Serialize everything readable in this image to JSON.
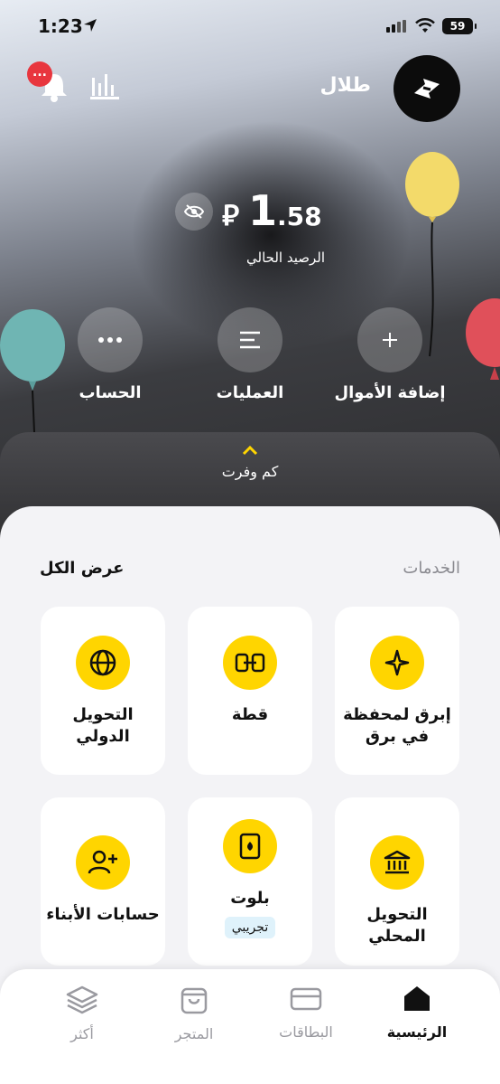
{
  "status_bar": {
    "time": "1:23",
    "battery": "59"
  },
  "header": {
    "user_name": "طلال",
    "notification_badge": "..."
  },
  "balance": {
    "currency_symbol": "⃁",
    "integer": "1",
    "decimal": ".58",
    "label": "الرصيد الحالي"
  },
  "quick_actions": [
    {
      "label": "إضافة الأموال",
      "icon": "plus-icon"
    },
    {
      "label": "العمليات",
      "icon": "list-icon"
    },
    {
      "label": "الحساب",
      "icon": "more-icon"
    }
  ],
  "savings": {
    "label": "كم وفرت"
  },
  "services": {
    "title": "الخدمات",
    "view_all": "عرض الكل",
    "cards": [
      {
        "label": "إبرق لمحفظة في برق",
        "icon": "spark-icon"
      },
      {
        "label": "قطة",
        "icon": "split-icon"
      },
      {
        "label": "التحويل الدولي",
        "icon": "globe-icon"
      },
      {
        "label": "التحويل المحلي",
        "icon": "bank-icon"
      },
      {
        "label": "بلوت",
        "icon": "cards-icon",
        "badge": "تجريبي"
      },
      {
        "label": "حسابات الأبناء",
        "icon": "add-user-icon"
      }
    ]
  },
  "tabbar": [
    {
      "label": "الرئيسية",
      "icon": "home-icon",
      "active": true
    },
    {
      "label": "البطاقات",
      "icon": "card-icon"
    },
    {
      "label": "المتجر",
      "icon": "bag-icon"
    },
    {
      "label": "أكثر",
      "icon": "layers-icon"
    }
  ],
  "colors": {
    "accent": "#ffd500",
    "badge": "#e8363e",
    "trial_bg": "#dff2fb"
  }
}
